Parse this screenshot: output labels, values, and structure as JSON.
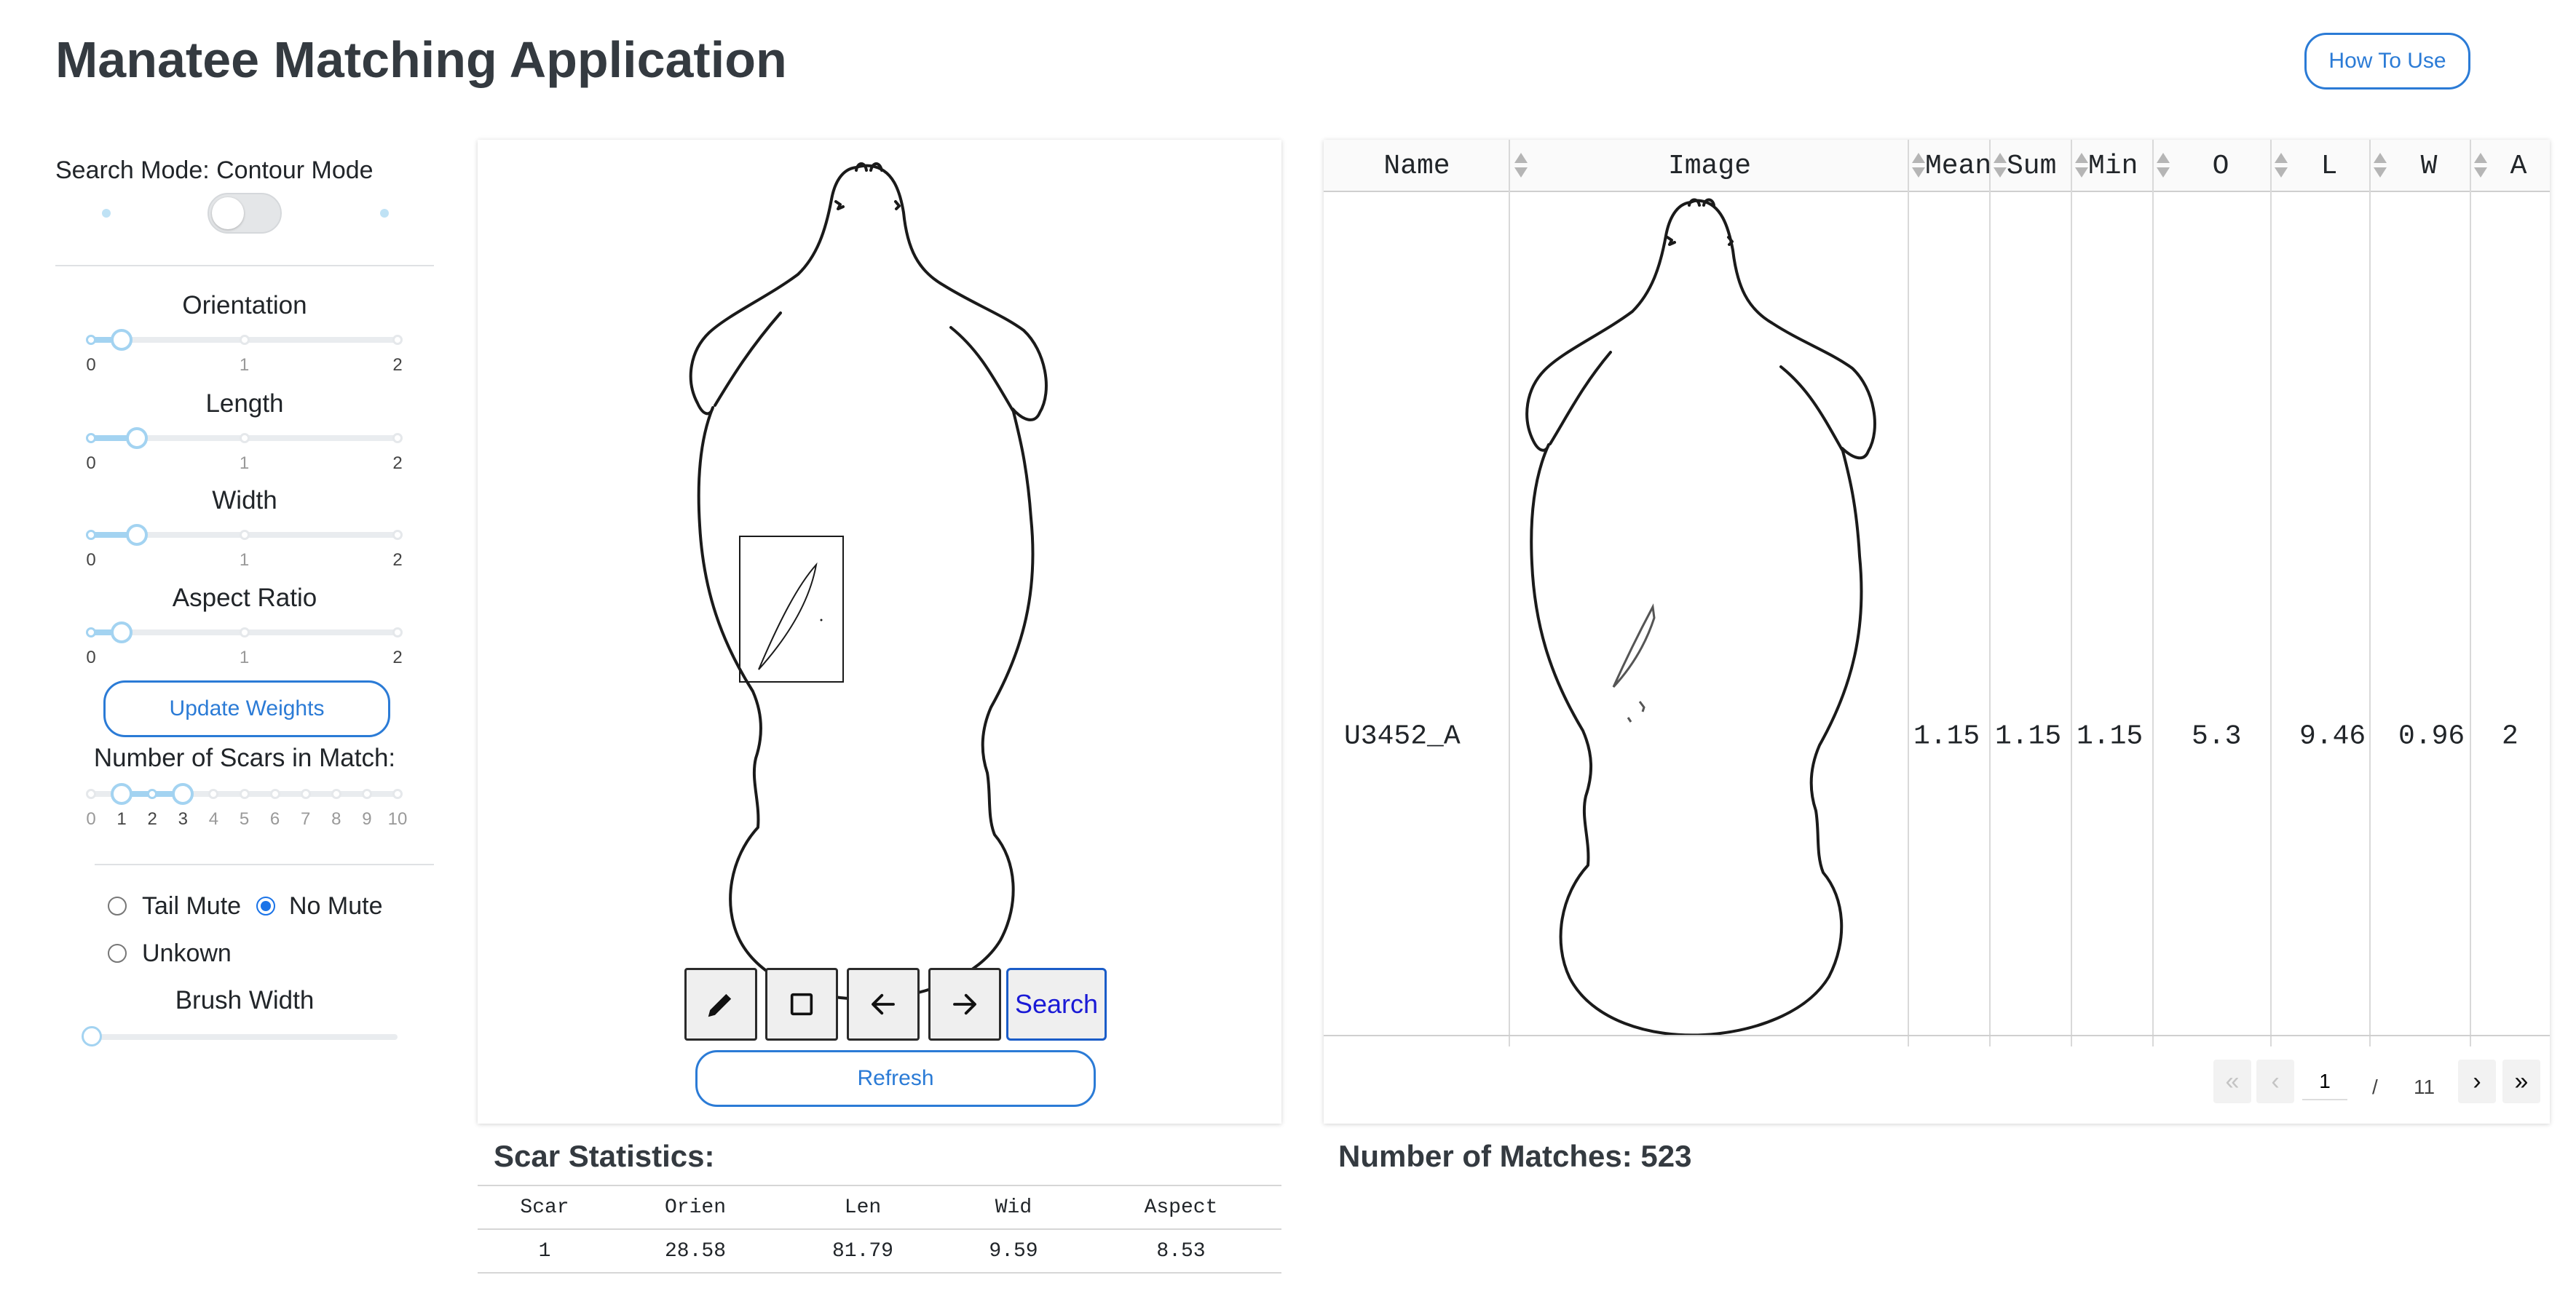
{
  "app": {
    "title": "Manatee Matching Application",
    "how_to_label": "How To Use"
  },
  "controls": {
    "search_mode_label": "Search Mode: Contour Mode",
    "sliders": [
      {
        "label": "Orientation",
        "value": 0.2,
        "min_label": "0",
        "mid_label": "1",
        "max_label": "2"
      },
      {
        "label": "Length",
        "value": 0.3,
        "min_label": "0",
        "mid_label": "1",
        "max_label": "2"
      },
      {
        "label": "Width",
        "value": 0.3,
        "min_label": "0",
        "mid_label": "1",
        "max_label": "2"
      },
      {
        "label": "Aspect Ratio",
        "value": 0.2,
        "min_label": "0",
        "mid_label": "1",
        "max_label": "2"
      }
    ],
    "update_weights_label": "Update Weights",
    "scars_label": "Number of Scars in Match:",
    "scars_ticks": [
      "0",
      "1",
      "2",
      "3",
      "4",
      "5",
      "6",
      "7",
      "8",
      "9",
      "10"
    ],
    "scars_range": [
      1,
      3
    ],
    "radio_tail_mute": "Tail Mute",
    "radio_no_mute": "No Mute",
    "radio_unknown": "Unkown",
    "brush_width_label": "Brush Width",
    "brush_width_value": 0
  },
  "canvas": {
    "search_label": "Search",
    "refresh_label": "Refresh"
  },
  "scar_stats": {
    "title": "Scar Statistics:",
    "headers": [
      "Scar",
      "Orien",
      "Len",
      "Wid",
      "Aspect"
    ],
    "rows": [
      [
        "1",
        "28.58",
        "81.79",
        "9.59",
        "8.53"
      ]
    ]
  },
  "results": {
    "headers": [
      "Name",
      "Image",
      "Mean",
      "Sum",
      "Min",
      "O",
      "L",
      "W",
      "A"
    ],
    "row": {
      "name": "U3452_A",
      "mean": "1.15",
      "sum": "1.15",
      "min": "1.15",
      "o": "5.3",
      "l": "9.46",
      "w": "0.96",
      "a": "2"
    },
    "pager": {
      "current": "1",
      "separator": "/",
      "total": "11"
    },
    "matches_label": "Number of Matches: 523"
  }
}
